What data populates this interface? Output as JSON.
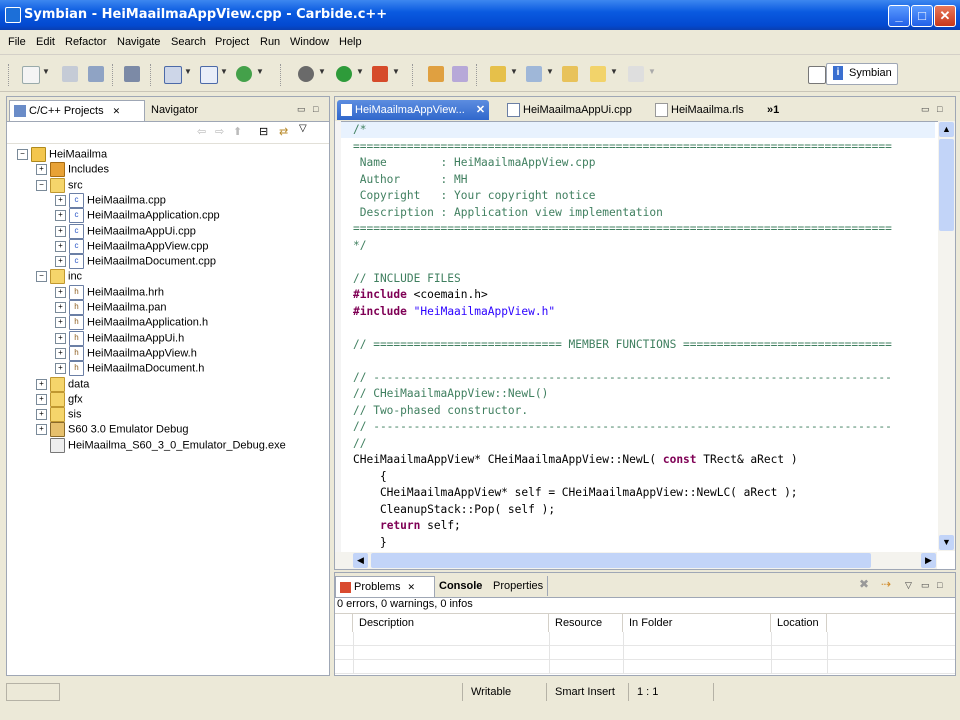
{
  "window": {
    "title": "Symbian - HeiMaailmaAppView.cpp - Carbide.c++"
  },
  "menu": [
    "File",
    "Edit",
    "Refactor",
    "Navigate",
    "Search",
    "Project",
    "Run",
    "Window",
    "Help"
  ],
  "toolbar": {
    "perspective_label": "Symbian"
  },
  "left_panel": {
    "tabs": [
      {
        "label": "C/C++ Projects"
      },
      {
        "label": "Navigator"
      }
    ],
    "tree": [
      {
        "label": "HeiMaailma",
        "icon": "project-icon",
        "level": 0,
        "toggle": "−"
      },
      {
        "label": "Includes",
        "icon": "includes-icon",
        "level": 1,
        "toggle": "+"
      },
      {
        "label": "src",
        "icon": "folder-icon",
        "level": 1,
        "toggle": "−"
      },
      {
        "label": "HeiMaailma.cpp",
        "icon": "cpp-file-icon",
        "level": 2,
        "toggle": "+"
      },
      {
        "label": "HeiMaailmaApplication.cpp",
        "icon": "cpp-file-icon",
        "level": 2,
        "toggle": "+"
      },
      {
        "label": "HeiMaailmaAppUi.cpp",
        "icon": "cpp-file-icon",
        "level": 2,
        "toggle": "+"
      },
      {
        "label": "HeiMaailmaAppView.cpp",
        "icon": "cpp-file-icon",
        "level": 2,
        "toggle": "+"
      },
      {
        "label": "HeiMaailmaDocument.cpp",
        "icon": "cpp-file-icon",
        "level": 2,
        "toggle": "+"
      },
      {
        "label": "inc",
        "icon": "folder-icon",
        "level": 1,
        "toggle": "−"
      },
      {
        "label": "HeiMaailma.hrh",
        "icon": "header-file-icon",
        "level": 2,
        "toggle": "+"
      },
      {
        "label": "HeiMaailma.pan",
        "icon": "header-file-icon",
        "level": 2,
        "toggle": "+"
      },
      {
        "label": "HeiMaailmaApplication.h",
        "icon": "header-file-icon",
        "level": 2,
        "toggle": "+"
      },
      {
        "label": "HeiMaailmaAppUi.h",
        "icon": "header-file-icon",
        "level": 2,
        "toggle": "+"
      },
      {
        "label": "HeiMaailmaAppView.h",
        "icon": "header-file-icon",
        "level": 2,
        "toggle": "+"
      },
      {
        "label": "HeiMaailmaDocument.h",
        "icon": "header-file-icon",
        "level": 2,
        "toggle": "+"
      },
      {
        "label": "data",
        "icon": "folder-icon",
        "level": 1,
        "toggle": "+"
      },
      {
        "label": "gfx",
        "icon": "folder-icon",
        "level": 1,
        "toggle": "+"
      },
      {
        "label": "sis",
        "icon": "folder-icon",
        "level": 1,
        "toggle": "+"
      },
      {
        "label": "S60 3.0 Emulator Debug",
        "icon": "binaries-folder-icon",
        "level": 1,
        "toggle": "+"
      },
      {
        "label": "HeiMaailma_S60_3_0_Emulator_Debug.exe",
        "icon": "exe-file-icon",
        "level": 1,
        "toggle": ""
      }
    ]
  },
  "editor": {
    "tabs": [
      {
        "label": "HeiMaailmaAppView..."
      },
      {
        "label": "HeiMaailmaAppUi.cpp"
      },
      {
        "label": "HeiMaailma.rls"
      },
      {
        "label": "»1"
      }
    ],
    "lines": [
      "/*",
      "================================================================================",
      " Name        : HeiMaailmaAppView.cpp",
      " Author      : MH",
      " Copyright   : Your copyright notice",
      " Description : Application view implementation",
      "================================================================================",
      "*/",
      "",
      "// INCLUDE FILES",
      "#include <coemain.h>",
      "#include \"HeiMaailmaAppView.h\"",
      "",
      "// ============================ MEMBER FUNCTIONS ===============================",
      "",
      "// -----------------------------------------------------------------------------",
      "// CHeiMaailmaAppView::NewL()",
      "// Two-phased constructor.",
      "// -----------------------------------------------------------------------------",
      "//",
      "CHeiMaailmaAppView* CHeiMaailmaAppView::NewL( const TRect& aRect )",
      "    {",
      "    CHeiMaailmaAppView* self = CHeiMaailmaAppView::NewLC( aRect );",
      "    CleanupStack::Pop( self );",
      "    return self;",
      "    }"
    ]
  },
  "bottom_panel": {
    "tabs": [
      {
        "label": "Problems"
      },
      {
        "label": "Console"
      },
      {
        "label": "Properties"
      }
    ],
    "summary": "0 errors, 0 warnings, 0 infos",
    "columns": [
      "Description",
      "Resource",
      "In Folder",
      "Location"
    ]
  },
  "status": {
    "writable": "Writable",
    "insert_mode": "Smart Insert",
    "position": "1 : 1"
  }
}
